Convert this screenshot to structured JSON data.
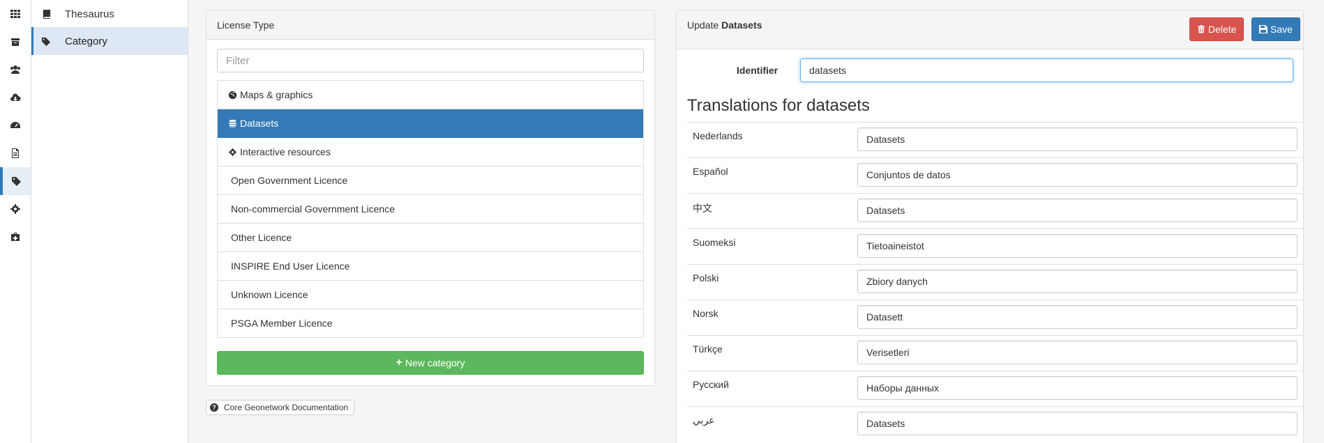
{
  "rail": {
    "items": [
      {
        "icon": "grid-icon"
      },
      {
        "icon": "archive-icon"
      },
      {
        "icon": "users-icon"
      },
      {
        "icon": "cloud-download-icon"
      },
      {
        "icon": "dashboard-icon"
      },
      {
        "icon": "file-icon"
      },
      {
        "icon": "tags-icon",
        "active": true
      },
      {
        "icon": "gear-icon"
      },
      {
        "icon": "medkit-icon"
      }
    ]
  },
  "submenu": {
    "items": [
      {
        "label": "Thesaurus",
        "icon": "book-icon"
      },
      {
        "label": "Category",
        "icon": "tags-icon",
        "active": true
      }
    ]
  },
  "left_panel": {
    "heading": "License Type",
    "filter_placeholder": "Filter",
    "items": [
      {
        "label": "Maps & graphics",
        "icon": "globe-icon"
      },
      {
        "label": "Datasets",
        "icon": "database-icon",
        "active": true
      },
      {
        "label": "Interactive resources",
        "icon": "cog-icon"
      },
      {
        "label": "Open Government Licence"
      },
      {
        "label": "Non-commercial Government Licence"
      },
      {
        "label": "Other Licence"
      },
      {
        "label": "INSPIRE End User Licence"
      },
      {
        "label": "Unknown Licence"
      },
      {
        "label": "PSGA Member Licence"
      }
    ],
    "new_button": "New category"
  },
  "doc_link": "Core Geonetwork Documentation",
  "right_panel": {
    "heading_prefix": "Update",
    "heading_name": "Datasets",
    "delete_label": "Delete",
    "save_label": "Save",
    "identifier_label": "Identifier",
    "identifier_value": "datasets",
    "translations_title": "Translations for datasets",
    "translations": [
      {
        "lang": "Nederlands",
        "value": "Datasets"
      },
      {
        "lang": "Español",
        "value": "Conjuntos de datos"
      },
      {
        "lang": "中文",
        "value": "Datasets"
      },
      {
        "lang": "Suomeksi",
        "value": "Tietoaineistot"
      },
      {
        "lang": "Polski",
        "value": "Zbiory danych"
      },
      {
        "lang": "Norsk",
        "value": "Datasett"
      },
      {
        "lang": "Türkçe",
        "value": "Verisetleri"
      },
      {
        "lang": "Русский",
        "value": "Наборы данных"
      },
      {
        "lang": "عربي",
        "value": "Datasets"
      }
    ]
  },
  "colors": {
    "primary": "#337ab7",
    "danger": "#d9534f",
    "success": "#5cb85c"
  }
}
